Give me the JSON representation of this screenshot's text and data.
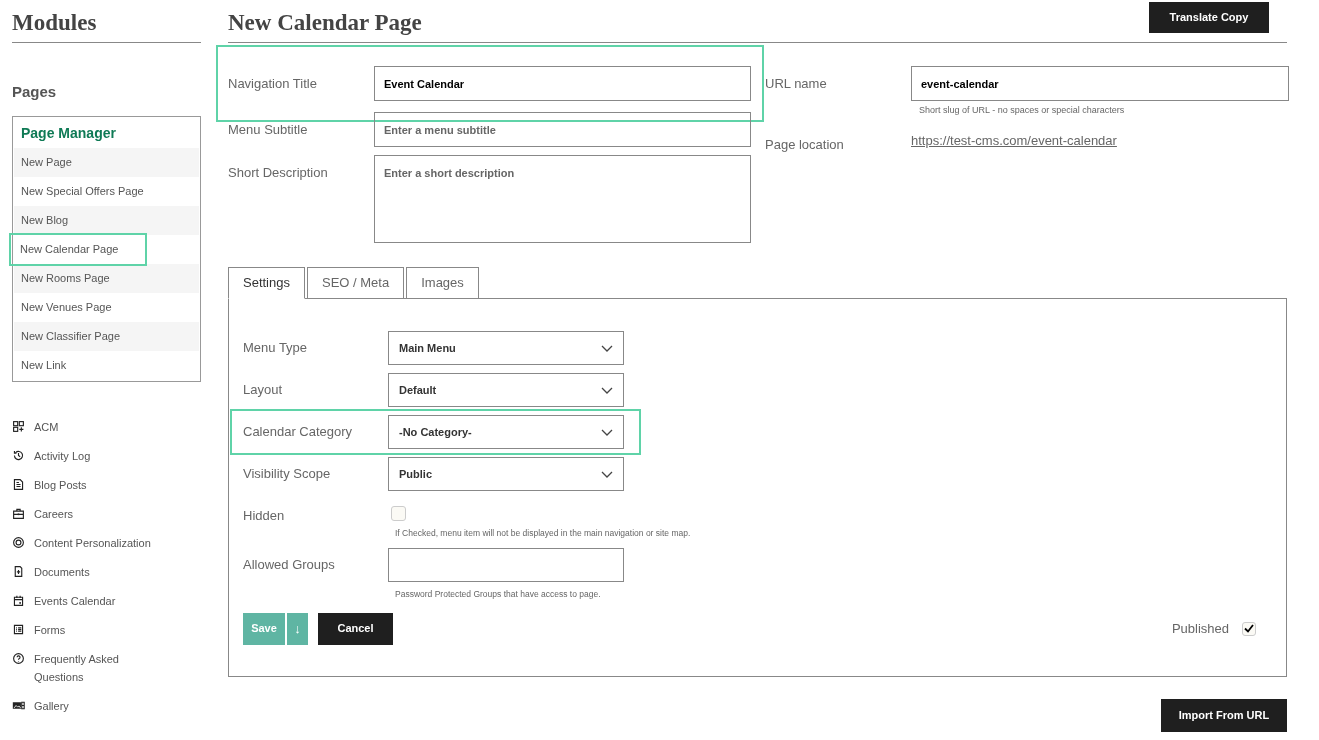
{
  "sidebar": {
    "title": "Modules",
    "section_title": "Pages",
    "page_manager": {
      "title": "Page Manager",
      "items": [
        {
          "label": "New Page",
          "highlighted": false
        },
        {
          "label": "New Special Offers Page",
          "highlighted": false
        },
        {
          "label": "New Blog",
          "highlighted": false
        },
        {
          "label": "New Calendar Page",
          "highlighted": true
        },
        {
          "label": "New Rooms Page",
          "highlighted": false
        },
        {
          "label": "New Venues Page",
          "highlighted": false
        },
        {
          "label": "New Classifier Page",
          "highlighted": false
        },
        {
          "label": "New Link",
          "highlighted": false
        }
      ]
    },
    "modules": [
      {
        "label": "ACM"
      },
      {
        "label": "Activity Log"
      },
      {
        "label": "Blog Posts"
      },
      {
        "label": "Careers"
      },
      {
        "label": "Content Personalization"
      },
      {
        "label": "Documents"
      },
      {
        "label": "Events Calendar"
      },
      {
        "label": "Forms"
      },
      {
        "label": "Frequently Asked Questions"
      },
      {
        "label": "Gallery"
      }
    ]
  },
  "header": {
    "title": "New Calendar Page",
    "translate_button": "Translate Copy"
  },
  "fields_left": [
    {
      "label": "Navigation Title",
      "value": "Event Calendar",
      "kind": "input",
      "highlighted": true
    },
    {
      "label": "Menu Subtitle",
      "placeholder": "Enter a menu subtitle",
      "kind": "input",
      "highlighted": false
    },
    {
      "label": "Short Description",
      "placeholder": "Enter a short description",
      "kind": "textarea",
      "highlighted": false
    }
  ],
  "url_name": {
    "label": "URL name",
    "value": "event-calendar",
    "hint": "Short slug of URL - no spaces or special characters"
  },
  "page_location": {
    "label": "Page location",
    "link": "https://test-cms.com/event-calendar"
  },
  "tabs": [
    {
      "label": "Settings",
      "selected": true
    },
    {
      "label": "SEO / Meta",
      "selected": false
    },
    {
      "label": "Images",
      "selected": false
    }
  ],
  "settings": [
    {
      "label": "Menu Type",
      "kind": "select",
      "value": "Main Menu",
      "highlighted": false
    },
    {
      "label": "Layout",
      "kind": "select",
      "value": "Default",
      "highlighted": false
    },
    {
      "label": "Calendar Category",
      "kind": "select",
      "value": "-No Category-",
      "highlighted": true
    },
    {
      "label": "Visibility Scope",
      "kind": "select",
      "value": "Public",
      "highlighted": false
    },
    {
      "label": "Hidden",
      "kind": "checkbox",
      "checked": false,
      "hint": "If Checked, menu item will not be displayed in the main navigation or site map.",
      "highlighted": false
    },
    {
      "label": "Allowed Groups",
      "kind": "input",
      "hint": "Password Protected Groups that have access to page.",
      "highlighted": false
    }
  ],
  "actions": {
    "save": "Save",
    "save_more": "↓",
    "cancel": "Cancel",
    "published": {
      "label": "Published",
      "checked": true
    }
  },
  "import_button": "Import From URL"
}
